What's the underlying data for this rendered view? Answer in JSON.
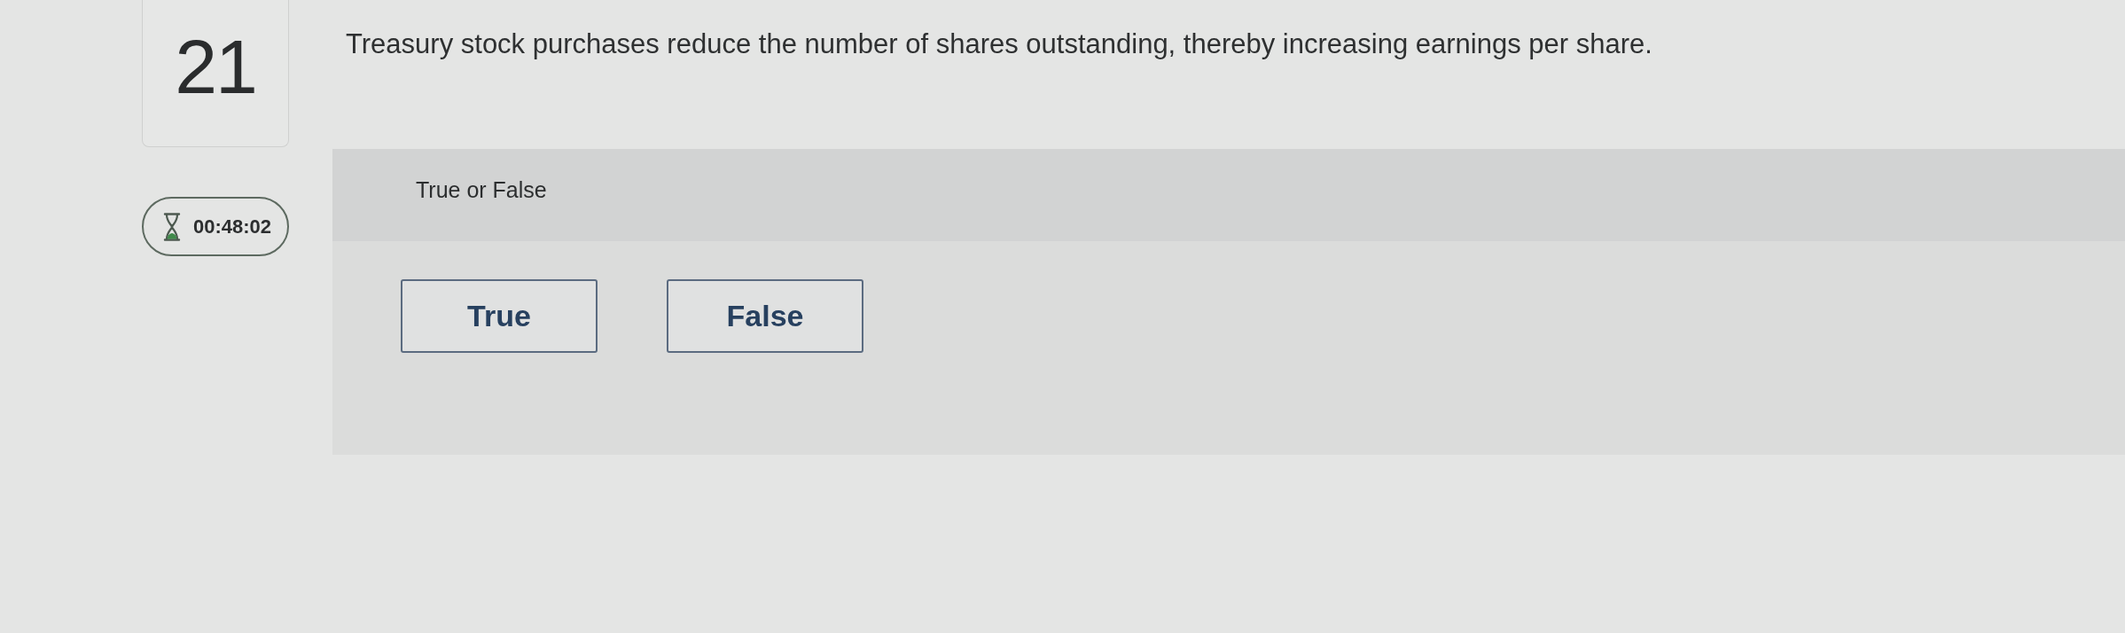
{
  "question": {
    "number": "21",
    "text": "Treasury stock purchases reduce the number of shares outstanding, thereby increasing earnings per share.",
    "timer": "00:48:02"
  },
  "answer_panel": {
    "prompt": "True or False",
    "options": [
      {
        "label": "True",
        "selected": false
      },
      {
        "label": "False",
        "selected": false
      }
    ]
  }
}
